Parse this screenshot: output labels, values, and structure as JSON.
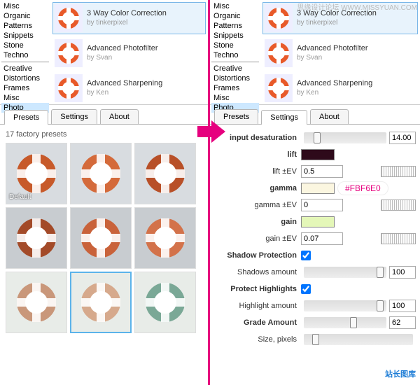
{
  "watermarks": {
    "top": "思缘设计论坛 WWW.MISSYUAN.COM",
    "bottom": "站长图库"
  },
  "categories": [
    "Misc",
    "Organic",
    "Patterns",
    "Snippets",
    "Stone",
    "Techno",
    "—",
    "Creative",
    "Distortions",
    "Frames",
    "Misc",
    "Photo"
  ],
  "category_selected": "Photo",
  "items": [
    {
      "title": "3 Way Color Correction",
      "by": "by tinkerpixel"
    },
    {
      "title": "Advanced Photofilter",
      "by": "by Svan"
    },
    {
      "title": "Advanced Sharpening",
      "by": "by Ken"
    }
  ],
  "tabs": {
    "presets": "Presets",
    "settings": "Settings",
    "about": "About"
  },
  "presets": {
    "title": "17 factory presets",
    "default_label": "Default"
  },
  "grid_colors": [
    "#c75a2a",
    "#d46a3a",
    "#b85028",
    "#a34a28",
    "#c9623a",
    "#d3724a",
    "#c9977a",
    "#d6a98c",
    "#7aa896"
  ],
  "settings": {
    "input_desaturation_label": "input desaturation",
    "input_desaturation": "14.00",
    "lift_label": "lift",
    "lift_color": "#2e0a1a",
    "lift_ev_label": "lift ±EV",
    "lift_ev": "0.5",
    "gamma_label": "gamma",
    "gamma_color": "#fbf6e0",
    "gamma_pill": "#FBF6E0",
    "gamma_ev_label": "gamma ±EV",
    "gamma_ev": "0",
    "gain_label": "gain",
    "gain_color": "#e4f7b8",
    "gain_ev_label": "gain ±EV",
    "gain_ev": "0.07",
    "shadow_protection_label": "Shadow Protection",
    "shadows_amount_label": "Shadows amount",
    "shadows_amount": "100",
    "protect_highlights_label": "Protect Highlights",
    "highlight_amount_label": "Highlight amount",
    "highlight_amount": "100",
    "grade_amount_label": "Grade Amount",
    "grade_amount": "62",
    "size_pixels_label": "Size, pixels"
  }
}
